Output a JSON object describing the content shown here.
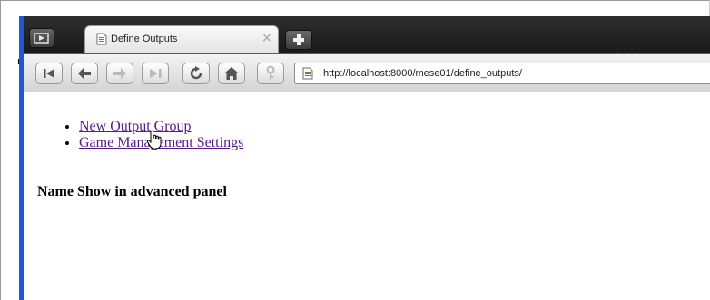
{
  "browser": {
    "tab": {
      "title": "Define Outputs",
      "close_symbol": "×",
      "favicon": "page-icon"
    },
    "new_tab_icon": "plus-icon",
    "panel_toggle_icon": "sidebar-panel-icon",
    "tab_overflow": "• • •",
    "toolbar": {
      "buttons": [
        {
          "name": "first-icon",
          "enabled": true
        },
        {
          "name": "back-icon",
          "enabled": true
        },
        {
          "name": "forward-icon",
          "enabled": false
        },
        {
          "name": "last-icon",
          "enabled": false
        },
        {
          "name": "reload-icon",
          "enabled": true
        },
        {
          "name": "home-icon",
          "enabled": true
        },
        {
          "name": "key-icon",
          "enabled": false
        }
      ]
    },
    "address_bar": {
      "url": "http://localhost:8000/mese01/define_outputs/",
      "icon": "page-icon"
    }
  },
  "page": {
    "links": [
      {
        "label": "New Output Group"
      },
      {
        "label": "Game Management Settings"
      }
    ],
    "table_header": "Name Show in advanced panel",
    "cursor": "hand-pointer-icon"
  },
  "colors": {
    "tab_bar": "#242424",
    "left_accent": "#1f56d6",
    "link_visited": "#551a8b"
  }
}
